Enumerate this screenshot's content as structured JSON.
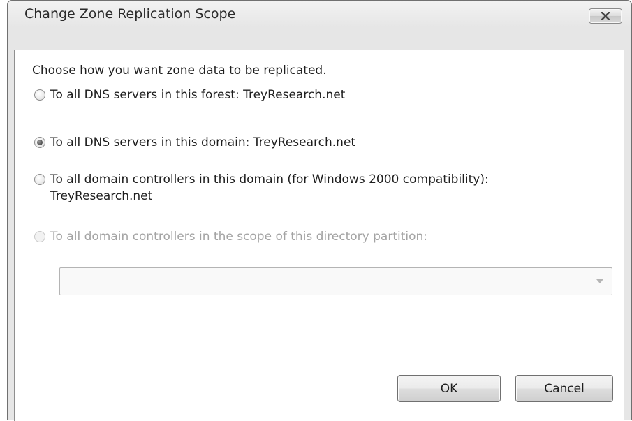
{
  "dialog": {
    "title": "Change Zone Replication Scope",
    "close_icon": "close-icon"
  },
  "content": {
    "prompt": "Choose how you want zone data to be replicated.",
    "options": [
      {
        "label_line1": "To all DNS servers in this forest: TreyResearch.net",
        "label_line2": "",
        "checked": false,
        "enabled": true
      },
      {
        "label_line1": "To all DNS servers in this domain: TreyResearch.net",
        "label_line2": "",
        "checked": true,
        "enabled": true
      },
      {
        "label_line1": "To all domain controllers in this domain (for Windows 2000 compatibility):",
        "label_line2": "TreyResearch.net",
        "checked": false,
        "enabled": true
      },
      {
        "label_line1": "To all domain controllers in the scope of this directory partition:",
        "label_line2": "",
        "checked": false,
        "enabled": false
      }
    ],
    "partition_select": {
      "value": "",
      "enabled": false
    }
  },
  "buttons": {
    "ok_label": "OK",
    "cancel_label": "Cancel"
  },
  "colors": {
    "window_frame": "#e6e6e6",
    "client_bg": "#ffffff",
    "disabled_text": "#a3a3a3"
  }
}
